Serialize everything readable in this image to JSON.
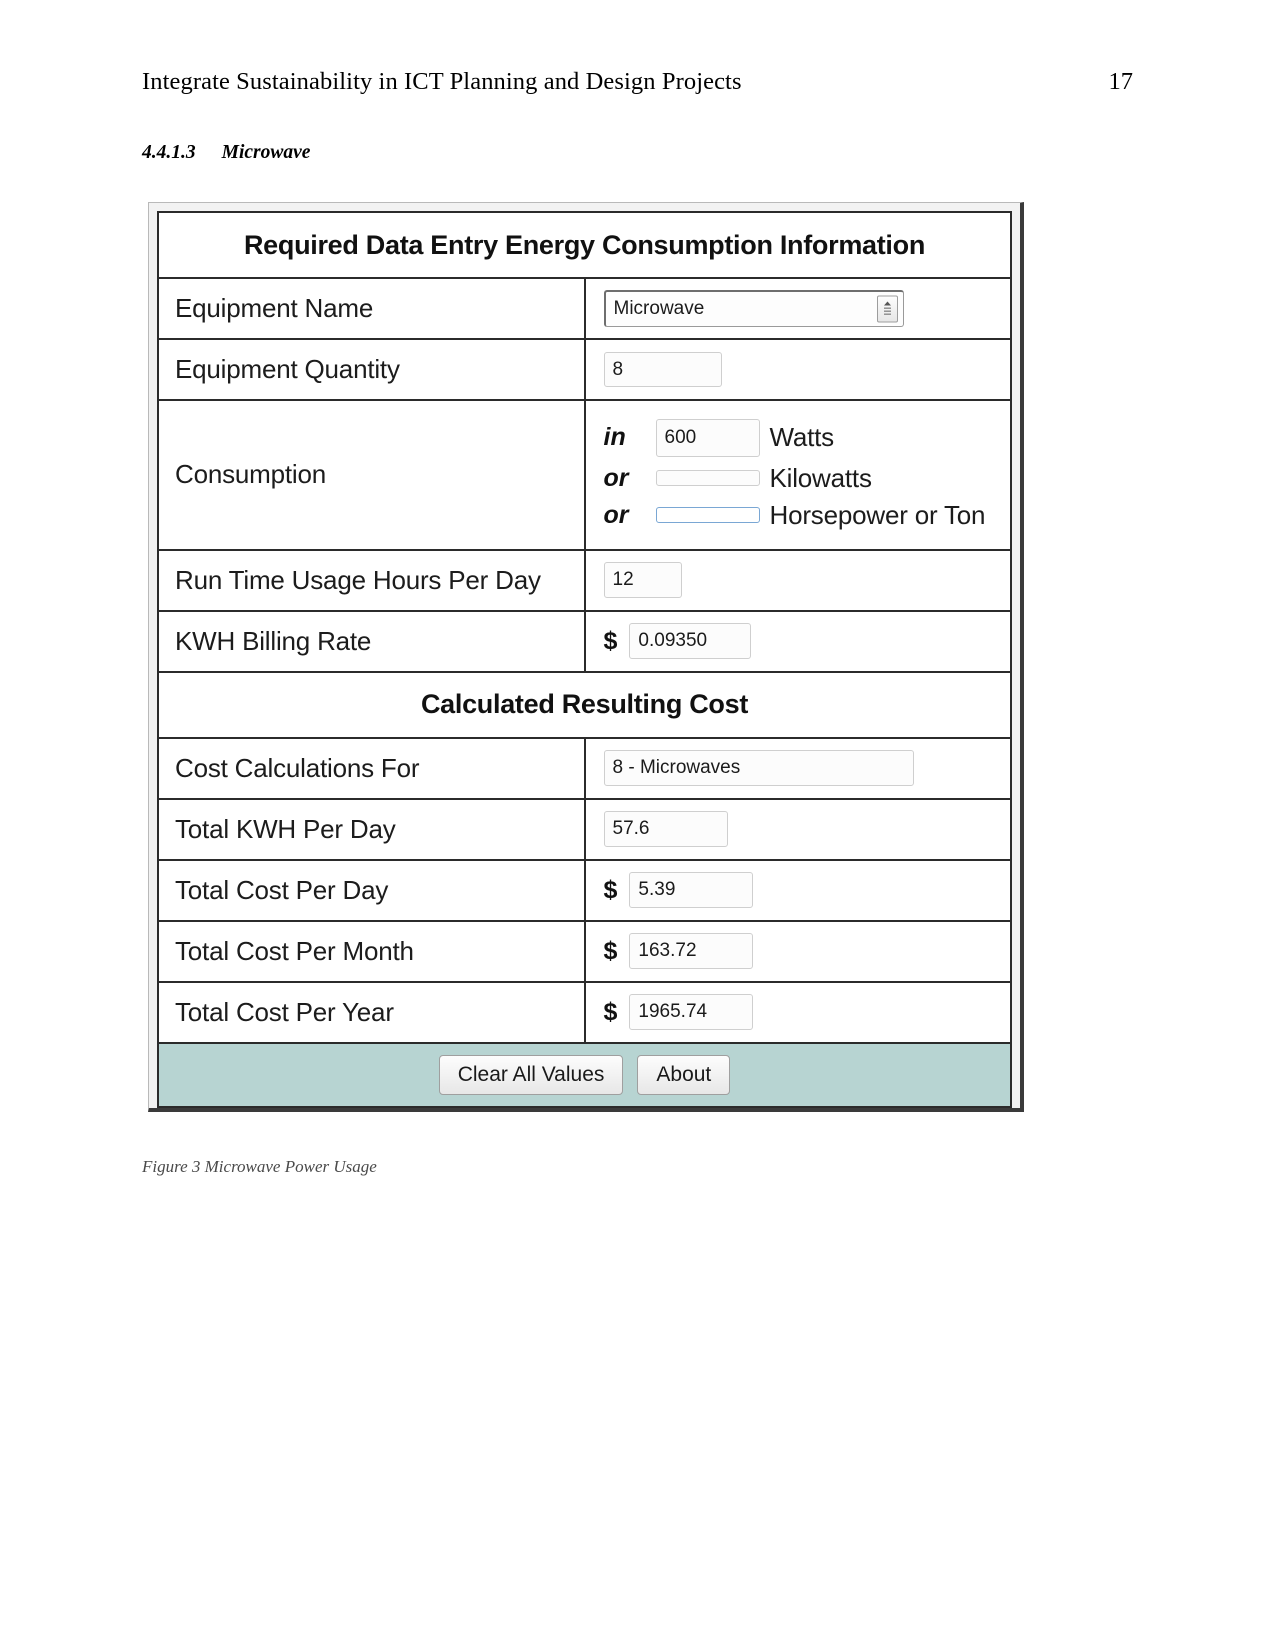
{
  "page": {
    "running_head": "Integrate Sustainability in ICT Planning and Design Projects",
    "page_number": "17",
    "section_number": "4.4.1.3",
    "section_title": "Microwave",
    "figure_caption": "Figure 3 Microwave Power Usage"
  },
  "app": {
    "entry_band_title": "Required Data Entry Energy Consumption Information",
    "results_band_title": "Calculated Resulting Cost",
    "rows": {
      "equipment_name": {
        "label": "Equipment Name",
        "value": "Microwave"
      },
      "equipment_quantity": {
        "label": "Equipment Quantity",
        "value": "8"
      },
      "consumption": {
        "label": "Consumption",
        "lines": [
          {
            "conjunction": "in",
            "value": "600",
            "unit": "Watts"
          },
          {
            "conjunction": "or",
            "value": "",
            "unit": "Kilowatts"
          },
          {
            "conjunction": "or",
            "value": "",
            "unit": "Horsepower or Ton"
          }
        ]
      },
      "run_time": {
        "label": "Run Time Usage Hours Per Day",
        "value": "12"
      },
      "billing_rate": {
        "label": "KWH Billing Rate",
        "currency": "$",
        "value": "0.09350"
      },
      "cost_calculations_for": {
        "label": "Cost Calculations For",
        "value": "8 - Microwaves"
      },
      "total_kwh_per_day": {
        "label": "Total KWH Per Day",
        "value": "57.6"
      },
      "total_cost_per_day": {
        "label": "Total Cost Per Day",
        "currency": "$",
        "value": "5.39"
      },
      "total_cost_per_month": {
        "label": "Total Cost Per Month",
        "currency": "$",
        "value": "163.72"
      },
      "total_cost_per_year": {
        "label": "Total Cost Per Year",
        "currency": "$",
        "value": "1965.74"
      }
    },
    "buttons": {
      "clear": "Clear All Values",
      "about": "About"
    }
  },
  "colors": {
    "band_teal": "#b7d4d2",
    "border_dark": "#2b2b2b",
    "focus_blue": "#7aa7d4"
  }
}
